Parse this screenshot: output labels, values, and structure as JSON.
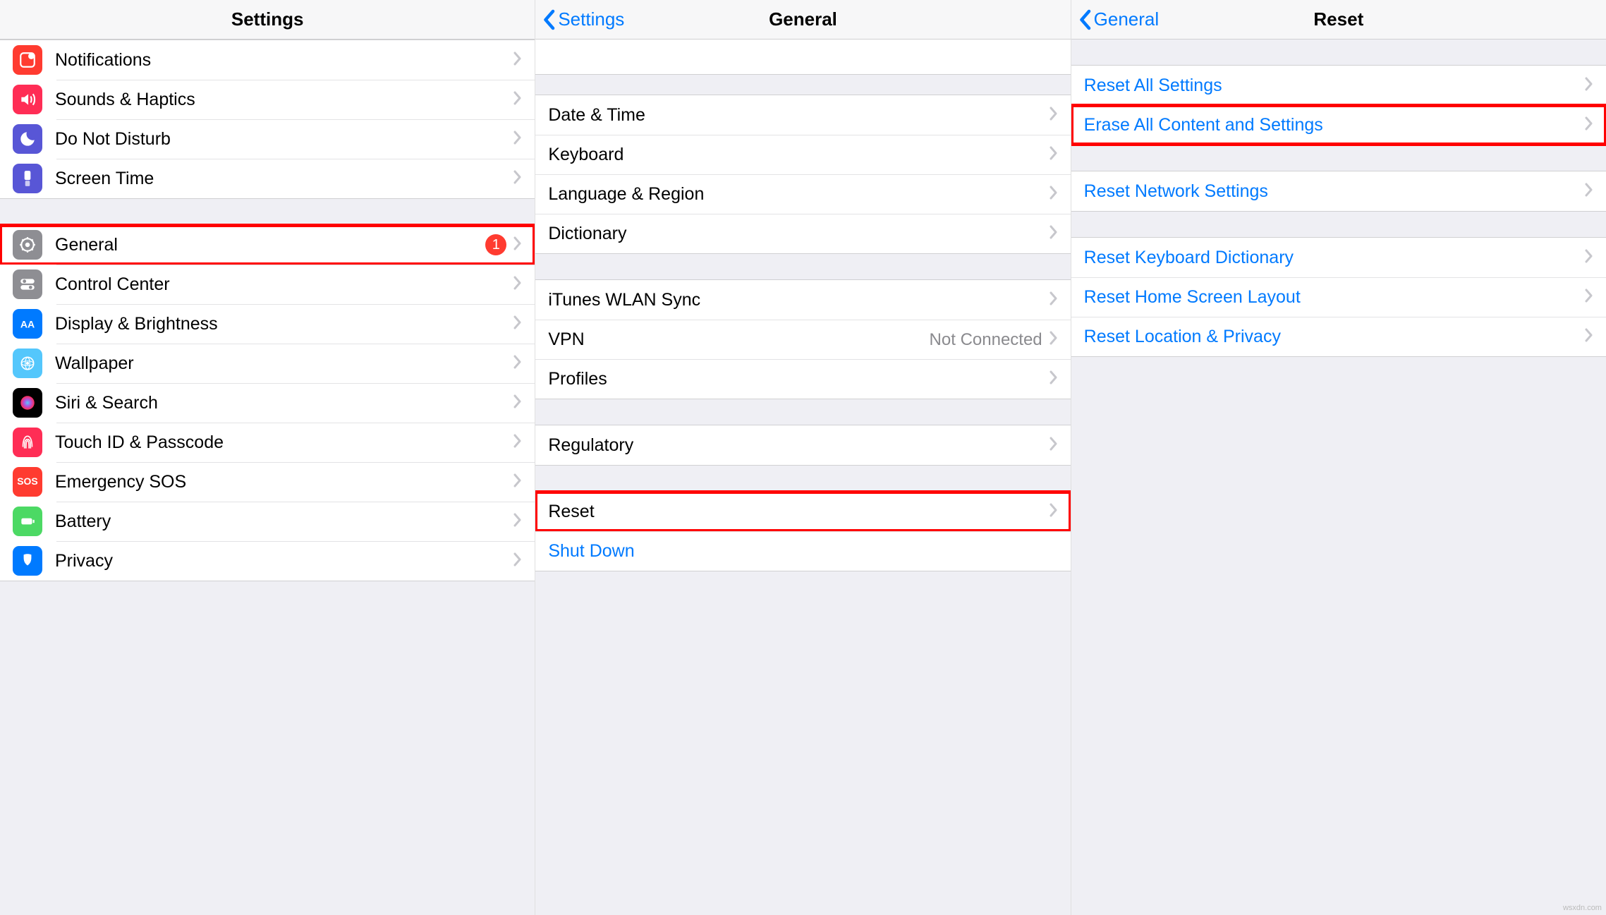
{
  "panel1": {
    "title": "Settings",
    "group1": [
      {
        "label": "Notifications",
        "icon": "notifications",
        "color": "#ff3b30"
      },
      {
        "label": "Sounds & Haptics",
        "icon": "sounds",
        "color": "#ff2d55"
      },
      {
        "label": "Do Not Disturb",
        "icon": "dnd",
        "color": "#5856d6"
      },
      {
        "label": "Screen Time",
        "icon": "screentime",
        "color": "#5856d6"
      }
    ],
    "group2": [
      {
        "label": "General",
        "icon": "general",
        "color": "#8e8e93",
        "badge": "1",
        "highlight": true
      },
      {
        "label": "Control Center",
        "icon": "controlcenter",
        "color": "#8e8e93"
      },
      {
        "label": "Display & Brightness",
        "icon": "display",
        "color": "#007aff"
      },
      {
        "label": "Wallpaper",
        "icon": "wallpaper",
        "color": "#54c7fc"
      },
      {
        "label": "Siri & Search",
        "icon": "siri",
        "color": "#000"
      },
      {
        "label": "Touch ID & Passcode",
        "icon": "touchid",
        "color": "#ff2d55"
      },
      {
        "label": "Emergency SOS",
        "icon": "sos",
        "color": "#ff3b30"
      },
      {
        "label": "Battery",
        "icon": "battery",
        "color": "#4cd964"
      },
      {
        "label": "Privacy",
        "icon": "privacy",
        "color": "#007aff"
      }
    ]
  },
  "panel2": {
    "title": "General",
    "back": "Settings",
    "group1": [
      {
        "label": "Date & Time"
      },
      {
        "label": "Keyboard"
      },
      {
        "label": "Language & Region"
      },
      {
        "label": "Dictionary"
      }
    ],
    "group2": [
      {
        "label": "iTunes WLAN Sync"
      },
      {
        "label": "VPN",
        "detail": "Not Connected"
      },
      {
        "label": "Profiles"
      }
    ],
    "group3": [
      {
        "label": "Regulatory"
      }
    ],
    "group4": [
      {
        "label": "Reset",
        "highlight": true
      },
      {
        "label": "Shut Down",
        "link": true,
        "no_chevron": true
      }
    ]
  },
  "panel3": {
    "title": "Reset",
    "back": "General",
    "group1": [
      {
        "label": "Reset All Settings",
        "link": true
      },
      {
        "label": "Erase All Content and Settings",
        "link": true,
        "highlight": true
      }
    ],
    "group2": [
      {
        "label": "Reset Network Settings",
        "link": true
      }
    ],
    "group3": [
      {
        "label": "Reset Keyboard Dictionary",
        "link": true
      },
      {
        "label": "Reset Home Screen Layout",
        "link": true
      },
      {
        "label": "Reset Location & Privacy",
        "link": true
      }
    ]
  },
  "watermark": "wsxdn.com"
}
